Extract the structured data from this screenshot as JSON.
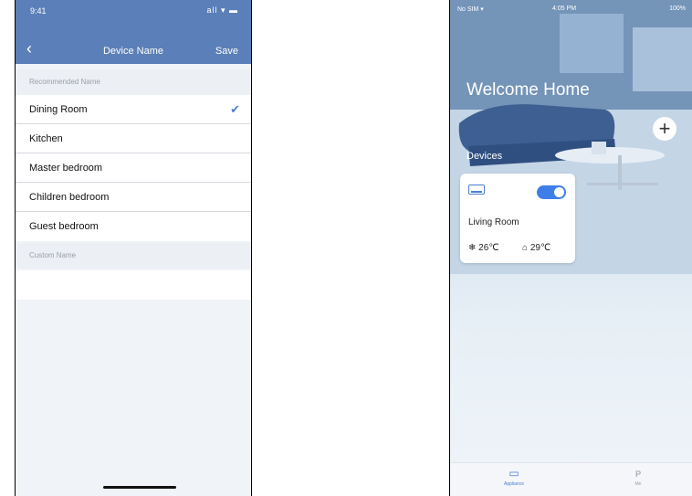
{
  "left_screen": {
    "status_time": "9:41",
    "status_icons": "all ▾ ▬",
    "header": {
      "back_glyph": "‹",
      "title": "Device Name",
      "save_label": "Save"
    },
    "recommended_header": "Recommended Name",
    "recommended_names": [
      {
        "label": "Dining Room",
        "selected": true,
        "check_glyph": "✔"
      },
      {
        "label": "Kitchen"
      },
      {
        "label": "Master bedroom"
      },
      {
        "label": "Children bedroom"
      },
      {
        "label": "Guest bedroom"
      }
    ],
    "custom_header": "Custom Name",
    "custom_name_value": ""
  },
  "right_screen": {
    "status_left": "No SIM ▾",
    "status_center": "4:05 PM",
    "status_right": "100%",
    "welcome_title": "Welcome Home",
    "add_glyph": "+",
    "devices_header": "Devices",
    "device": {
      "name": "Living Room",
      "power_on": true,
      "set_temp": "❄ 26℃",
      "room_temp": "⌂ 29℃"
    },
    "tabs": [
      {
        "label": "Appliance",
        "icon": "appliance-icon",
        "glyph": "▭",
        "active": true
      },
      {
        "label": "Me",
        "icon": "person-icon",
        "glyph": "ᴘ",
        "active": false
      }
    ],
    "accent_color": "#3f7ee8",
    "header_color": "#5b7fb8"
  }
}
